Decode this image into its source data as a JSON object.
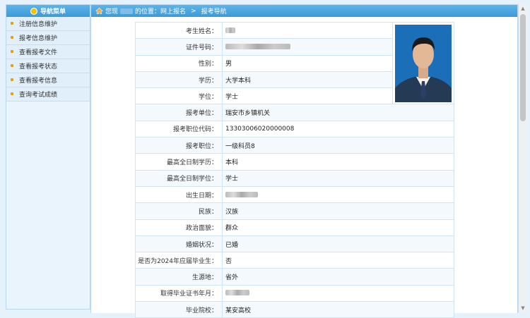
{
  "sidebar": {
    "title": "导航菜单",
    "items": [
      {
        "label": "注册信息维护"
      },
      {
        "label": "报考信息维护"
      },
      {
        "label": "查看报考文件"
      },
      {
        "label": "查看报考状态"
      },
      {
        "label": "查看报考信息"
      },
      {
        "label": "查询考试成绩"
      }
    ]
  },
  "breadcrumb": {
    "prefix": "您现",
    "suffix": "的位置：网上报名",
    "separator": ">",
    "current": "报考导航"
  },
  "fields": [
    {
      "label": "考生姓名：",
      "value": ""
    },
    {
      "label": "证件号码：",
      "value": ""
    },
    {
      "label": "性别：",
      "value": "男"
    },
    {
      "label": "学历：",
      "value": "大学本科"
    },
    {
      "label": "学位：",
      "value": "学士"
    },
    {
      "label": "报考单位：",
      "value": "瑞安市乡镇机关"
    },
    {
      "label": "报考职位代码：",
      "value": "13303006020000008"
    },
    {
      "label": "报考职位：",
      "value": "一级科员8"
    },
    {
      "label": "最高全日制学历：",
      "value": "本科"
    },
    {
      "label": "最高全日制学位：",
      "value": "学士"
    },
    {
      "label": "出生日期：",
      "value": ""
    },
    {
      "label": "民族：",
      "value": "汉族"
    },
    {
      "label": "政治面貌：",
      "value": "群众"
    },
    {
      "label": "婚姻状况：",
      "value": "已婚"
    },
    {
      "label": "是否为2024年应届毕业生：",
      "value": "否"
    },
    {
      "label": "生源地：",
      "value": "省外"
    },
    {
      "label": "取得毕业证书年月：",
      "value": ""
    },
    {
      "label": "毕业院校：",
      "value": "某安高校"
    }
  ],
  "colors": {
    "accent": "#3d9ad8",
    "sidebar_bg": "#e1effa",
    "photo_bg": "#1b6eb8"
  },
  "icons": {
    "sidebar_header": "menu-dot-icon",
    "breadcrumb": "home-icon",
    "bullet": "bullet-icon"
  }
}
